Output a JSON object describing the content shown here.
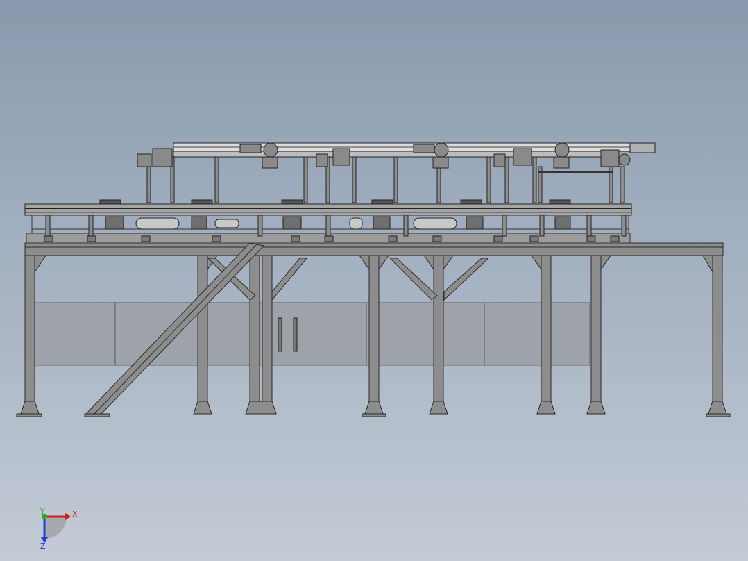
{
  "triad": {
    "x_label": "X",
    "y_label": "Y",
    "z_label": "Z",
    "x_color": "#d11f1f",
    "y_color": "#1fb31f",
    "z_color": "#1f3fd1"
  },
  "colors": {
    "steel_fill": "#8c8c8c",
    "steel_stroke": "#2b2b2b",
    "panel_fill": "#9aa0a8",
    "conveyor_light": "#d8d8d8"
  }
}
